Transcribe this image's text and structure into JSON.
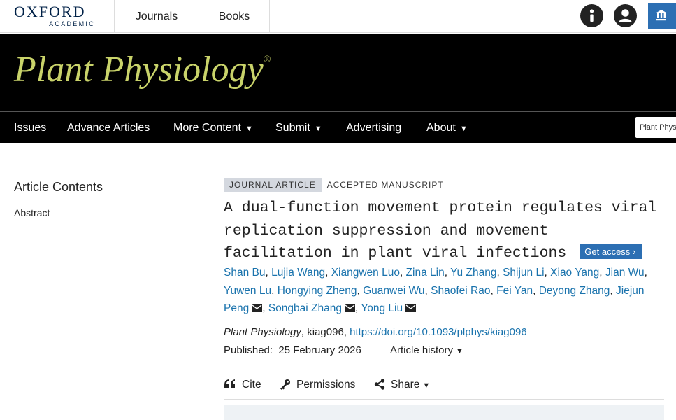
{
  "header": {
    "logo_main": "OXFORD",
    "logo_sub": "ACADEMIC",
    "links": [
      "Journals",
      "Books"
    ]
  },
  "banner": {
    "journal_title": "Plant Physiology",
    "registered": "®",
    "title_color": "#c9d36a"
  },
  "nav": {
    "items": [
      {
        "label": "Issues",
        "dropdown": false
      },
      {
        "label": "Advance Articles",
        "dropdown": false
      },
      {
        "label": "More Content",
        "dropdown": true
      },
      {
        "label": "Submit",
        "dropdown": true
      },
      {
        "label": "Advertising",
        "dropdown": false
      },
      {
        "label": "About",
        "dropdown": true
      }
    ],
    "search_value": "Plant Phys"
  },
  "sidebar": {
    "title": "Article Contents",
    "links": [
      "Abstract"
    ]
  },
  "article": {
    "type_badge": "JOURNAL ARTICLE",
    "status_badge": "ACCEPTED MANUSCRIPT",
    "title": "A dual-function movement protein regulates viral replication suppression and movement facilitation in plant viral infections",
    "get_access": "Get access",
    "authors": [
      {
        "name": "Shan Bu",
        "corresponding": false
      },
      {
        "name": "Lujia Wang",
        "corresponding": false
      },
      {
        "name": "Xiangwen Luo",
        "corresponding": false
      },
      {
        "name": "Zina Lin",
        "corresponding": false
      },
      {
        "name": "Yu Zhang",
        "corresponding": false
      },
      {
        "name": "Shijun Li",
        "corresponding": false
      },
      {
        "name": "Xiao Yang",
        "corresponding": false
      },
      {
        "name": "Jian Wu",
        "corresponding": false
      },
      {
        "name": "Yuwen Lu",
        "corresponding": false
      },
      {
        "name": "Hongying Zheng",
        "corresponding": false
      },
      {
        "name": "Guanwei Wu",
        "corresponding": false
      },
      {
        "name": "Shaofei Rao",
        "corresponding": false
      },
      {
        "name": "Fei Yan",
        "corresponding": false
      },
      {
        "name": "Deyong Zhang",
        "corresponding": false
      },
      {
        "name": "Jiejun Peng",
        "corresponding": true
      },
      {
        "name": "Songbai Zhang",
        "corresponding": true
      },
      {
        "name": "Yong Liu",
        "corresponding": true
      }
    ],
    "citation_journal": "Plant Physiology",
    "citation_rest": ", kiag096, ",
    "doi": "https://doi.org/10.1093/plphys/kiag096",
    "published_label": "Published:",
    "published_date": "25 February 2026",
    "history_label": "Article history",
    "tools": {
      "cite": "Cite",
      "permissions": "Permissions",
      "share": "Share"
    }
  },
  "colors": {
    "link": "#1a73ad",
    "accent_button": "#2c6fb3",
    "banner_bg": "#000000"
  }
}
